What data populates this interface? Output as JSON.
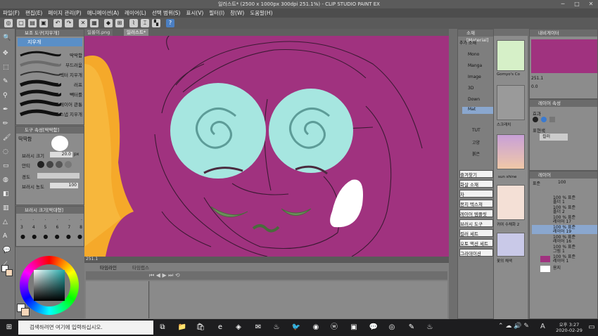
{
  "window": {
    "title": "일러스트* (2500 x 1000px 300dpi 251.1%) - CLIP STUDIO PAINT EX",
    "controls": [
      "─",
      "□",
      "✕"
    ]
  },
  "menu": [
    "파일(F)",
    "편집(E)",
    "페이지 관리(P)",
    "애니메이션(A)",
    "레이어(L)",
    "선택 범위(S)",
    "표시(V)",
    "필터(I)",
    "창(W)",
    "도움말(H)"
  ],
  "sub_tool_panel": {
    "header": "보조 도구[지우개]",
    "active_tool": "지우개",
    "brushes": [
      "딱딱함",
      "부드러움",
      "벡터 지우개",
      "러프",
      "빽터를",
      "레이어 관통",
      "스냅 지우개"
    ]
  },
  "tool_property": {
    "header": "도구 속성[딱딱함]",
    "name": "딱딱함",
    "size_label": "브러시 크기",
    "size_value": "20.0",
    "size_unit": "px",
    "antialias_label": "안티",
    "hardness_label": "경도",
    "density_label": "브러시 농도",
    "density_value": "100"
  },
  "brush_size_panel": {
    "header": "브러시 크기[막대형]",
    "values": [
      "3",
      "4",
      "5",
      "6",
      "7",
      "8"
    ]
  },
  "color_panel": {
    "main_color": "#ffffff",
    "sub_color": "#f7d7b9"
  },
  "canvas": {
    "tabs": [
      "일롱이.png",
      "일러스트*"
    ],
    "zoom": "251.1",
    "background_color": "#a0327f"
  },
  "timeline": {
    "tabs": [
      "타임라인",
      "타임랩스"
    ]
  },
  "material_panel": {
    "header": "소재[Material]",
    "tree": [
      "추가 소재",
      "Mono",
      "Manga",
      "Image",
      "3D",
      "Down",
      "Mat",
      "TUT",
      "고양",
      "붉은"
    ],
    "thumb_labels": [
      "Gomyo's Co",
      "스크래치",
      "sun shine",
      "귀여 수채화 2",
      "꽃의 채색"
    ],
    "buttons": [
      "즐겨찾기",
      "화살 소재",
      "차",
      "몽지 텍스쳐",
      "레이어 템플릿",
      "브러시 도구",
      "컬러 세트",
      "오토 액션 세트",
      "그라데이션"
    ]
  },
  "navigator_panel": {
    "header": "내비게이터",
    "zoom": "251.1",
    "angle": "0.0"
  },
  "layer_property": {
    "header": "레이어 속성",
    "effect_label": "효과",
    "expression_label": "표현색",
    "expression_value": "컬러"
  },
  "layer_panel": {
    "header": "레이어",
    "blend": "표준",
    "opacity": "100",
    "layers": [
      {
        "name": "100 % 표준\n폴더 1"
      },
      {
        "name": "100 % 표준\n폴더 2"
      },
      {
        "name": "100 % 표준\n레이어 17"
      },
      {
        "name": "100 % 표준\n레이어 19"
      },
      {
        "name": "100 % 표준\n레이어 16"
      },
      {
        "name": "100 % 표준\n그림 1"
      },
      {
        "name": "100 % 표준\n레이어 1"
      },
      {
        "name": "용지"
      }
    ]
  },
  "taskbar": {
    "search_placeholder": "검색하려면 여기에 입력하십시오.",
    "time": "오후 3:27",
    "date": "2020-02-29",
    "ime": "A"
  }
}
